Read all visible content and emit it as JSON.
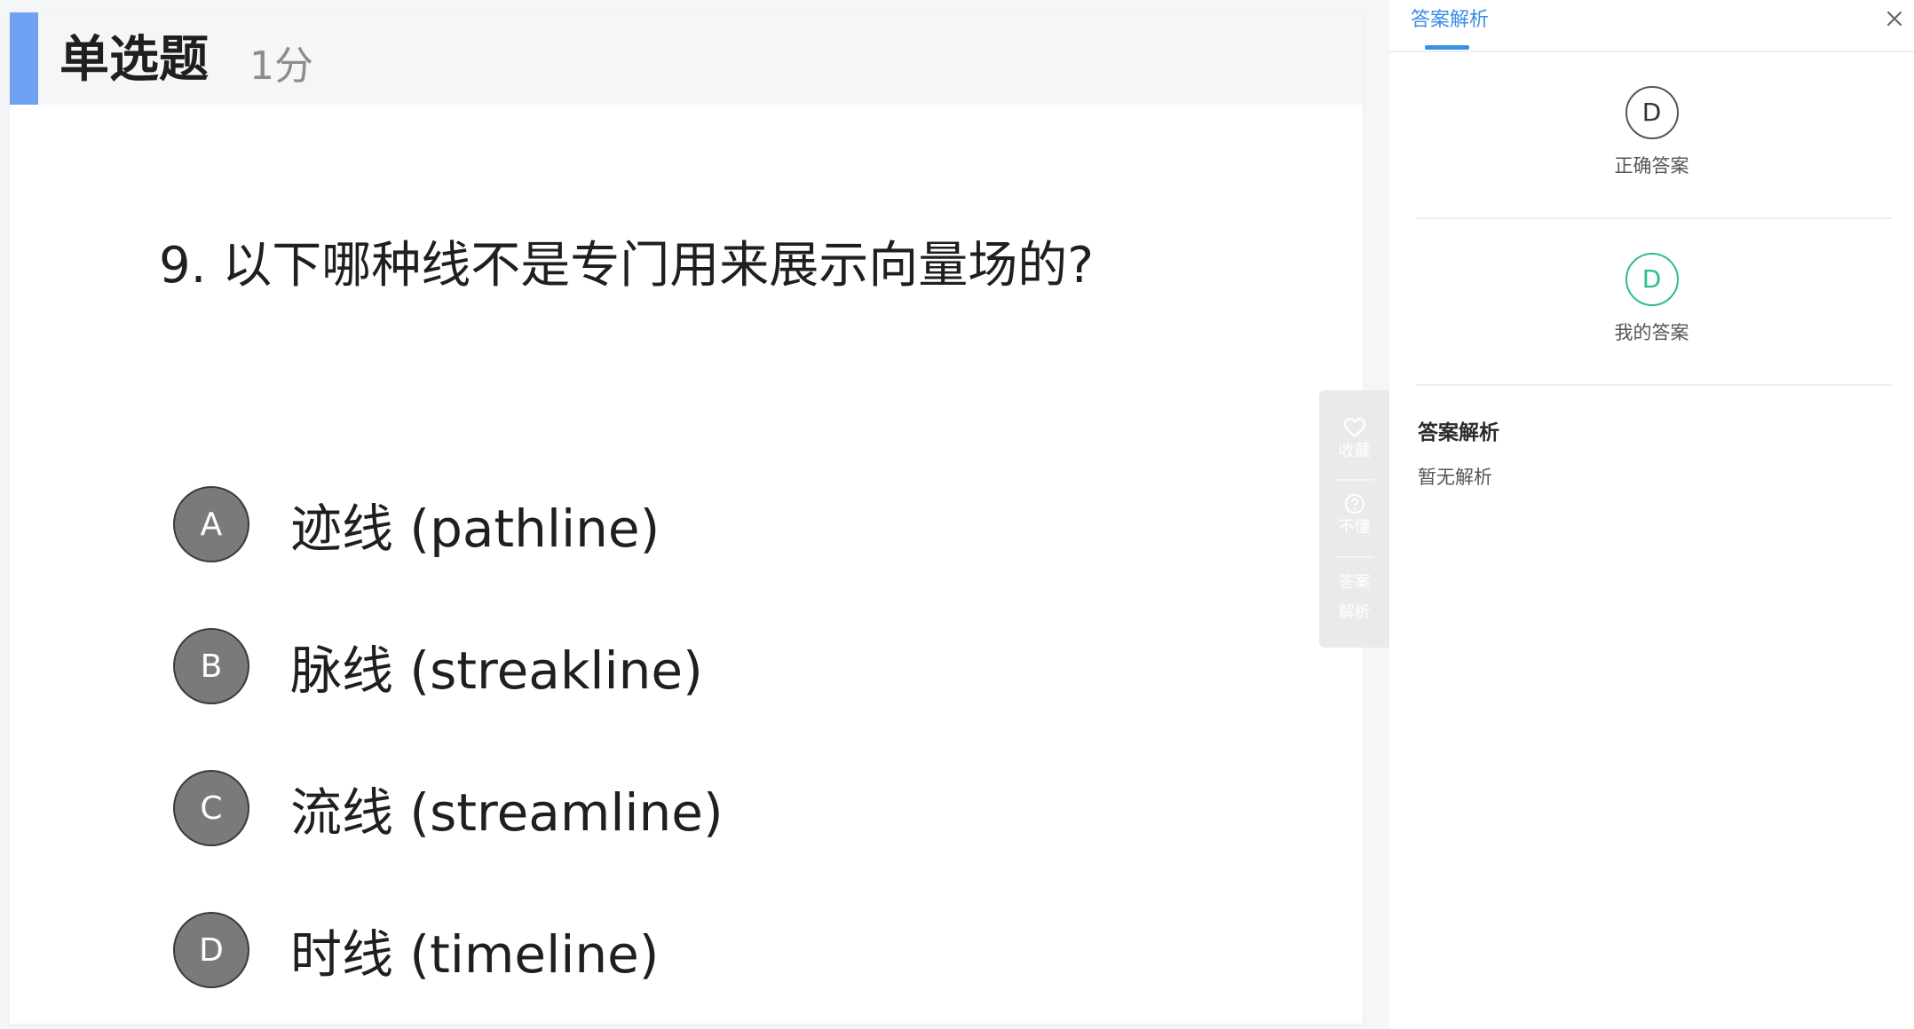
{
  "question": {
    "type_label": "单选题",
    "score_label": "1分",
    "stem": "9. 以下哪种线不是专门用来展示向量场的?",
    "options": [
      {
        "letter": "A",
        "text": "迹线 (pathline)"
      },
      {
        "letter": "B",
        "text": "脉线 (streakline)"
      },
      {
        "letter": "C",
        "text": "流线 (streamline)"
      },
      {
        "letter": "D",
        "text": "时线 (timeline)"
      }
    ]
  },
  "toolbar": {
    "favorite_label": "收藏",
    "dont_understand_label": "不懂",
    "analysis_label_line1": "答案",
    "analysis_label_line2": "解析"
  },
  "panel": {
    "tab_label": "答案解析",
    "correct_answer": "D",
    "correct_answer_label": "正确答案",
    "my_answer": "D",
    "my_answer_label": "我的答案",
    "analysis_title": "答案解析",
    "analysis_text": "暂无解析"
  },
  "colors": {
    "accent_blue": "#6fa2f5",
    "tab_blue": "#3a8ee6",
    "my_answer_green": "#2bbf8a",
    "option_badge_gray": "#7a7a7a"
  },
  "icons": {
    "favorite": "heart-icon",
    "dont_understand": "question-circle-icon",
    "close": "close-icon"
  }
}
